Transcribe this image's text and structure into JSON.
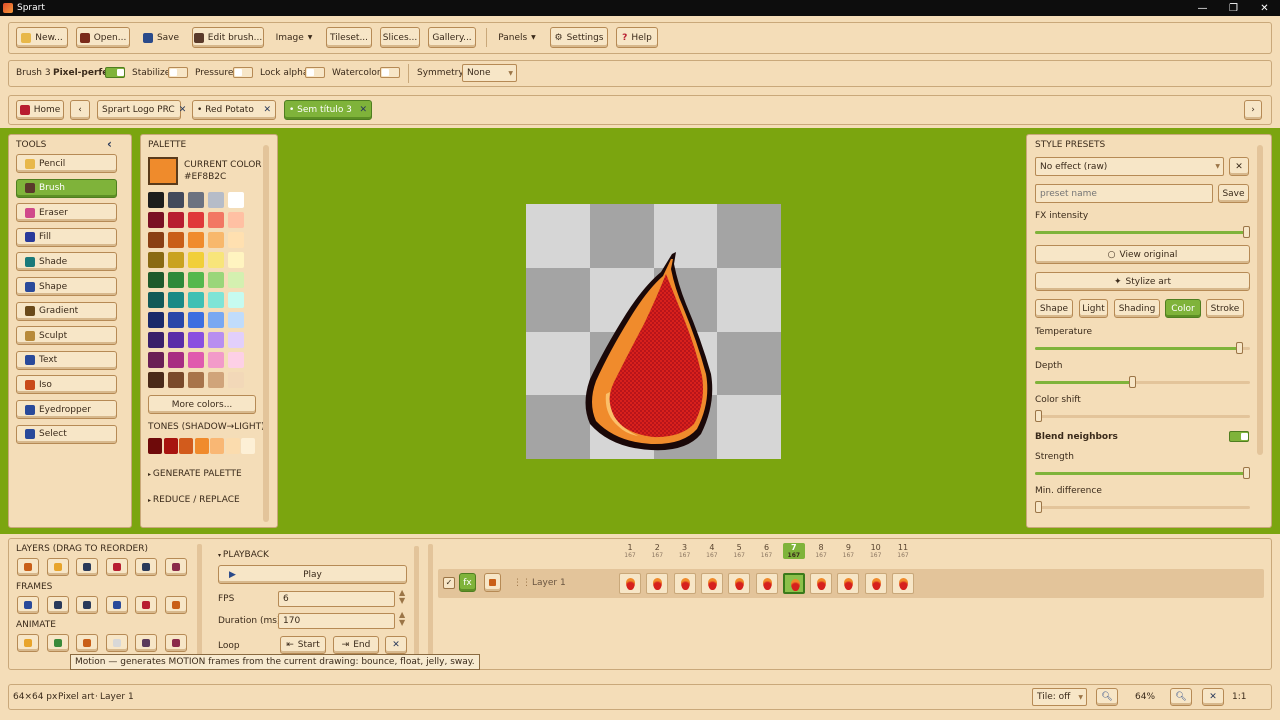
{
  "window": {
    "title": "Sprart"
  },
  "toolbar": {
    "new": "New...",
    "open": "Open...",
    "save": "Save",
    "edit_brush": "Edit brush...",
    "image": "Image",
    "tileset": "Tileset...",
    "slices": "Slices...",
    "gallery": "Gallery...",
    "panels": "Panels",
    "settings": "Settings",
    "help": "Help"
  },
  "brushbar": {
    "brush": "Brush 3",
    "pixel_perfect": "Pixel-perfect",
    "stabilize": "Stabilize",
    "pressure": "Pressure",
    "lock_alpha": "Lock alpha",
    "watercolor": "Watercolor",
    "symmetry": "Symmetry",
    "symmetry_value": "None"
  },
  "tabs": {
    "home": "Home",
    "t1": "Sprart Logo PRC",
    "t2": "Red Potato",
    "t3": "Sem título 3"
  },
  "tools": {
    "title": "TOOLS",
    "items": [
      "Pencil",
      "Brush",
      "Eraser",
      "Fill",
      "Shade",
      "Shape",
      "Gradient",
      "Sculpt",
      "Text",
      "Iso",
      "Eyedropper",
      "Select"
    ],
    "active": "Brush"
  },
  "palette": {
    "title": "PALETTE",
    "current_color_label": "CURRENT COLOR",
    "current_color_hex": "#EF8B2C",
    "current_color": "#EF8B2C",
    "more_colors": "More colors...",
    "tones_title": "TONES (SHADOW→LIGHT)",
    "generate": "GENERATE PALETTE",
    "reduce": "REDUCE / REPLACE",
    "rows": [
      [
        "#1d1d1d",
        "#434a5c",
        "#6c7280",
        "#b6bcc8",
        "#ffffff"
      ],
      [
        "#7a1025",
        "#b81d30",
        "#e0393a",
        "#f27763",
        "#ffc0a3"
      ],
      [
        "#8a3f13",
        "#c95f18",
        "#f08b2c",
        "#f8b86c",
        "#ffe0b0"
      ],
      [
        "#8a6a12",
        "#c9a220",
        "#f1cf3a",
        "#f8e57a",
        "#fff4c0"
      ],
      [
        "#1f5a2a",
        "#2f8a3a",
        "#56b84d",
        "#9ad67a",
        "#d4f0b0"
      ],
      [
        "#125a58",
        "#1a8a86",
        "#3fc0b4",
        "#7ee4d6",
        "#c6fbf0"
      ],
      [
        "#1a2a6a",
        "#2946a8",
        "#3e6fe0",
        "#79a8f2",
        "#c0dcfb"
      ],
      [
        "#3a1f6a",
        "#5a2ca8",
        "#8a4fe0",
        "#b88ef0",
        "#e2cffb"
      ],
      [
        "#6a1f55",
        "#a82d82",
        "#e05aae",
        "#f29ac9",
        "#fdd0e6"
      ],
      [
        "#4a2a18",
        "#7a4a2a",
        "#a8744a",
        "#d0a47a",
        "#f2d8b8"
      ]
    ],
    "tones": [
      "#6e0a0a",
      "#a8140f",
      "#d25b1c",
      "#f08b2c",
      "#f9b774",
      "#fbdcae",
      "#fdf0d6"
    ]
  },
  "style": {
    "title": "STYLE PRESETS",
    "preset": "No effect (raw)",
    "preset_placeholder": "preset name",
    "save": "Save",
    "fx_intensity": "FX intensity",
    "view_original": "View original",
    "stylize": "Stylize art",
    "tabs": [
      "Shape",
      "Light",
      "Shading",
      "Color",
      "Stroke"
    ],
    "active_tab": "Color",
    "temperature": "Temperature",
    "temperature_value": 0.95,
    "depth": "Depth",
    "depth_value": 0.45,
    "color_shift": "Color shift",
    "color_shift_value": 0.0,
    "blend_neighbors": "Blend neighbors",
    "strength": "Strength",
    "strength_value": 0.98,
    "min_difference": "Min. difference",
    "min_difference_value": 0.0,
    "fx_intensity_value": 1.0
  },
  "layers": {
    "title": "LAYERS (DRAG TO REORDER)",
    "frames": "FRAMES",
    "animate": "ANIMATE",
    "layer_name": "Layer 1",
    "fx": "fx"
  },
  "playback": {
    "title": "PLAYBACK",
    "play": "Play",
    "fps_label": "FPS",
    "fps": "6",
    "duration_label": "Duration (ms)",
    "duration": "170",
    "loop": "Loop",
    "start": "Start",
    "end": "End"
  },
  "timeline": {
    "frames": [
      {
        "n": "1",
        "d": "167"
      },
      {
        "n": "2",
        "d": "167"
      },
      {
        "n": "3",
        "d": "167"
      },
      {
        "n": "4",
        "d": "167"
      },
      {
        "n": "5",
        "d": "167"
      },
      {
        "n": "6",
        "d": "167"
      },
      {
        "n": "7",
        "d": "167"
      },
      {
        "n": "8",
        "d": "167"
      },
      {
        "n": "9",
        "d": "167"
      },
      {
        "n": "10",
        "d": "167"
      },
      {
        "n": "11",
        "d": "167"
      }
    ],
    "active": "7"
  },
  "tooltip": "Motion — generates MOTION frames from the current drawing: bounce, float, jelly, sway.",
  "status": {
    "size": "64×64 px",
    "mode": "Pixel art",
    "layer": "Layer 1",
    "tile": "Tile: off",
    "zoom": "64%",
    "ratio": "1:1"
  }
}
